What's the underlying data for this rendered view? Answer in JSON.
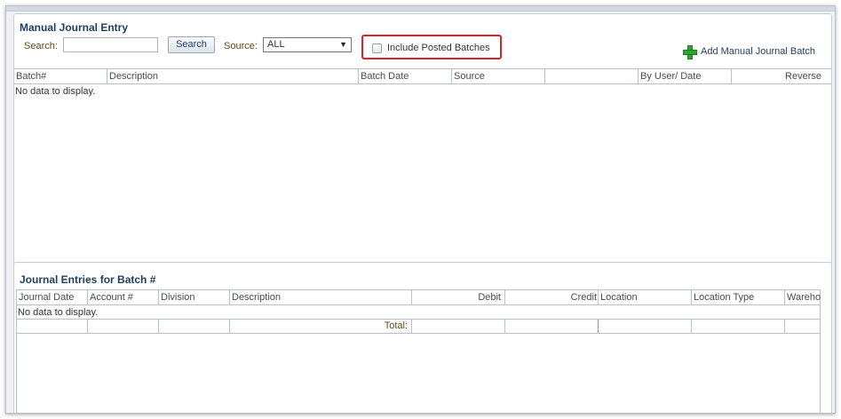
{
  "top_panel": {
    "title": "Manual Journal Entry",
    "search_label": "Search:",
    "search_value": "",
    "search_button": "Search",
    "source_label": "Source:",
    "source_value": "ALL",
    "include_posted_label": "Include Posted Batches",
    "include_posted_checked": false,
    "add_batch_label": "Add Manual Journal Batch",
    "columns": [
      "Batch#",
      "Description",
      "Batch Date",
      "Source",
      "",
      "By User/ Date",
      "Reverse"
    ],
    "empty_text": "No data to display."
  },
  "bottom_panel": {
    "title": "Journal Entries for Batch #",
    "columns": [
      "Journal Date",
      "Account #",
      "Division",
      "Description",
      "Debit",
      "Credit",
      "Location",
      "Location Type",
      "Wareho"
    ],
    "empty_text": "No data to display.",
    "total_label": "Total:"
  },
  "colors": {
    "title": "#1f3c5c",
    "highlight": "#d9232a",
    "add_icon": "#2ea52e"
  },
  "icons": {
    "add": "plus-icon",
    "dropdown": "chevron-down-icon"
  }
}
